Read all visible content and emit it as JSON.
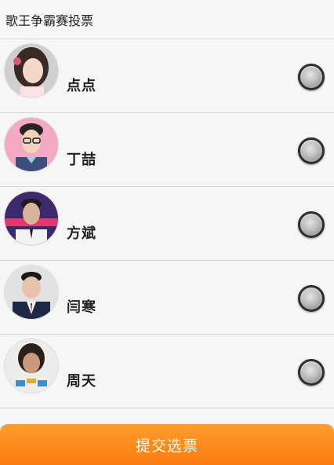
{
  "header": {
    "title": "歌王争霸赛投票"
  },
  "candidates": [
    {
      "name": "点点",
      "avatar": "female-singer-portrait"
    },
    {
      "name": "丁喆",
      "avatar": "male-singer-glasses-portrait"
    },
    {
      "name": "方斌",
      "avatar": "male-singer-stage-portrait"
    },
    {
      "name": "闫寒",
      "avatar": "male-singer-suit-portrait"
    },
    {
      "name": "周天",
      "avatar": "male-singer-costume-portrait"
    }
  ],
  "submit": {
    "label": "提交选票"
  },
  "colors": {
    "accent": "#fb7a0f",
    "background": "#f6f6f6"
  }
}
